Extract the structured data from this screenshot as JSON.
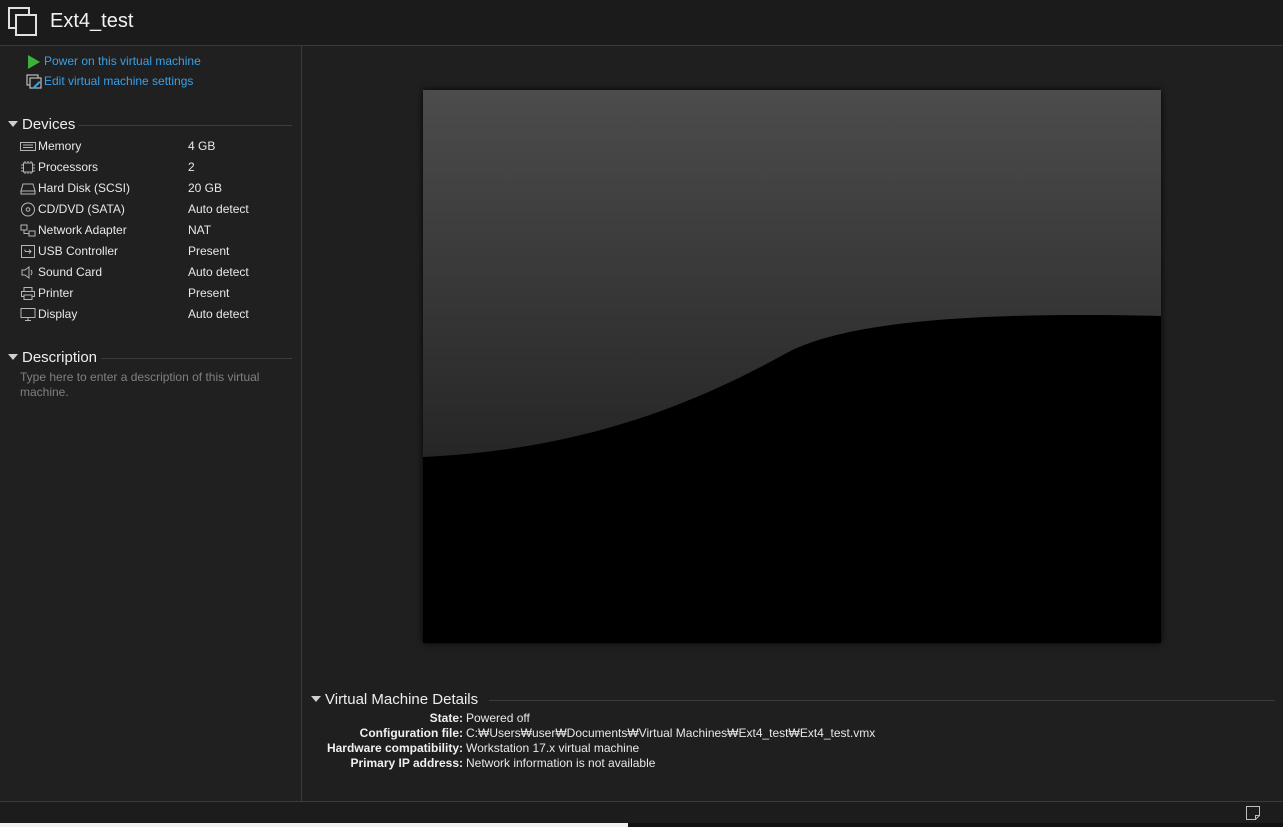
{
  "window": {
    "title": "Ext4_test"
  },
  "actions": [
    {
      "label": "Power on this virtual machine",
      "icon": "power-on-icon"
    },
    {
      "label": "Edit virtual machine settings",
      "icon": "edit-settings-icon"
    }
  ],
  "devices": {
    "header": "Devices",
    "items": [
      {
        "name": "Memory",
        "value": "4 GB",
        "icon": "memory-icon"
      },
      {
        "name": "Processors",
        "value": "2",
        "icon": "processor-icon"
      },
      {
        "name": "Hard Disk (SCSI)",
        "value": "20 GB",
        "icon": "hard-disk-icon"
      },
      {
        "name": "CD/DVD (SATA)",
        "value": "Auto detect",
        "icon": "cd-dvd-icon"
      },
      {
        "name": "Network Adapter",
        "value": "NAT",
        "icon": "network-adapter-icon"
      },
      {
        "name": "USB Controller",
        "value": "Present",
        "icon": "usb-icon"
      },
      {
        "name": "Sound Card",
        "value": "Auto detect",
        "icon": "sound-card-icon"
      },
      {
        "name": "Printer",
        "value": "Present",
        "icon": "printer-icon"
      },
      {
        "name": "Display",
        "value": "Auto detect",
        "icon": "display-icon"
      }
    ]
  },
  "description": {
    "header": "Description",
    "placeholder": "Type here to enter a description of this virtual machine."
  },
  "details": {
    "header": "Virtual Machine Details",
    "rows": [
      {
        "label": "State:",
        "value": "Powered off"
      },
      {
        "label": "Configuration file:",
        "value": "C:₩Users₩user₩Documents₩Virtual Machines₩Ext4_test₩Ext4_test.vmx"
      },
      {
        "label": "Hardware compatibility:",
        "value": "Workstation 17.x virtual machine"
      },
      {
        "label": "Primary IP address:",
        "value": "Network information is not available"
      }
    ]
  },
  "colors": {
    "link": "#3aa0e6",
    "power_green": "#3cb23c",
    "background": "#1f1f1f"
  }
}
